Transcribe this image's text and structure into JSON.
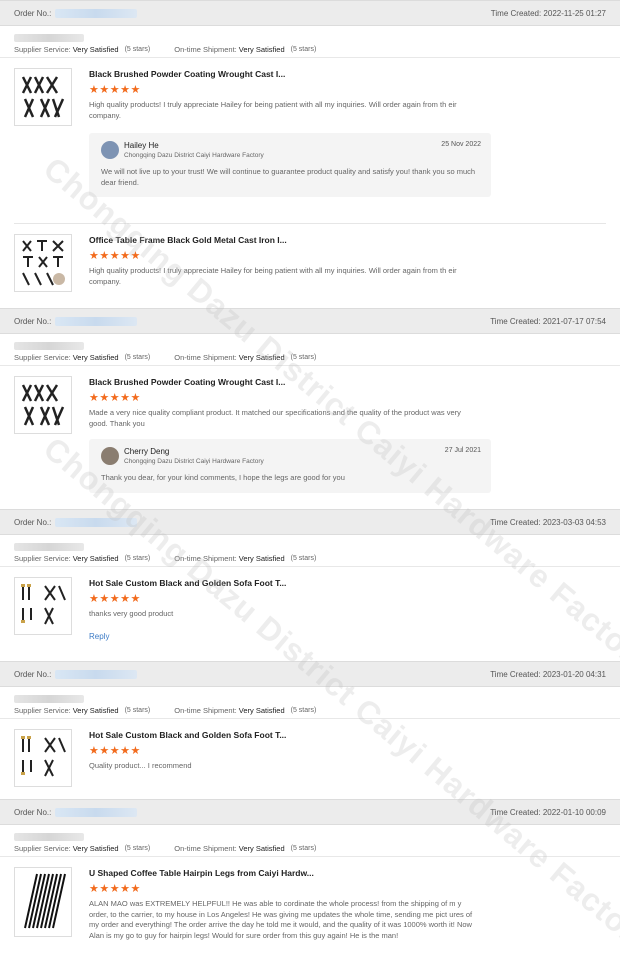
{
  "labels": {
    "order_no": "Order No.:",
    "time_created": "Time Created:",
    "supplier_service": "Supplier Service:",
    "ontime_shipment": "On-time Shipment:",
    "reply": "Reply"
  },
  "brand": {
    "star_color": "#f26b1d",
    "link_color": "#3c7bc6"
  },
  "watermark": "Chongqing Dazu District Caiyi Hardware Factory",
  "orders": [
    {
      "time_created": "2022-11-25 01:27",
      "supplier_service": "Very Satisfied",
      "supplier_stars": "(5 stars)",
      "shipment": "Very Satisfied",
      "shipment_stars": "(5 stars)",
      "reviews": [
        {
          "product": "Black Brushed Powder Coating Wrought Cast I...",
          "stars": "★★★★★",
          "comment": "High quality products! I truly appreciate Hailey for being patient with all my inquiries. Will order again from th eir company.",
          "reply": {
            "name": "Hailey He",
            "company": "Chongqing Dazu District Caiyi Hardware Factory",
            "date": "25 Nov 2022",
            "text": "We will not live up to your trust! We will continue to guarantee product quality and satisfy you! thank you so much dear friend."
          }
        },
        {
          "product": "Office Table Frame Black Gold Metal Cast Iron I...",
          "stars": "★★★★★",
          "comment": "High quality products! I truly appreciate Hailey for being patient with all my inquiries. Will order again from th eir company."
        }
      ]
    },
    {
      "time_created": "2021-07-17 07:54",
      "supplier_service": "Very Satisfied",
      "supplier_stars": "(5 stars)",
      "shipment": "Very Satisfied",
      "shipment_stars": "(5 stars)",
      "reviews": [
        {
          "product": "Black Brushed Powder Coating Wrought Cast I...",
          "stars": "★★★★★",
          "comment": "Made a very nice quality compliant product.  It matched our specifications and the quality of the product was very good.  Thank you",
          "reply": {
            "name": "Cherry Deng",
            "company": "Chongqing Dazu District Caiyi Hardware Factory",
            "date": "27 Jul 2021",
            "text": "Thank you dear, for your kind comments, I hope the legs are good for you"
          }
        }
      ]
    },
    {
      "time_created": "2023-03-03 04:53",
      "supplier_service": "Very Satisfied",
      "supplier_stars": "(5 stars)",
      "shipment": "Very Satisfied",
      "shipment_stars": "(5 stars)",
      "reviews": [
        {
          "product": "Hot Sale Custom Black and Golden Sofa Foot T...",
          "stars": "★★★★★",
          "comment": "thanks very good product"
        }
      ]
    },
    {
      "time_created": "2023-01-20 04:31",
      "supplier_service": "Very Satisfied",
      "supplier_stars": "(5 stars)",
      "shipment": "Very Satisfied",
      "shipment_stars": "(5 stars)",
      "reviews": [
        {
          "product": "Hot Sale Custom Black and Golden Sofa Foot T...",
          "stars": "★★★★★",
          "comment": "Quality product... I recommend"
        }
      ]
    },
    {
      "time_created": "2022-01-10 00:09",
      "supplier_service": "Very Satisfied",
      "supplier_stars": "(5 stars)",
      "shipment": "Very Satisfied",
      "shipment_stars": "(5 stars)",
      "reviews": [
        {
          "product": "U Shaped Coffee Table Hairpin Legs from Caiyi Hardw...",
          "stars": "★★★★★",
          "comment": "ALAN MAO was EXTREMELY HELPFUL!! He was able to cordinate the whole process! from the shipping of m y order, to the carrier, to my house in Los Angeles! He was giving me updates the whole time, sending me pict ures of my order and everything! The order arrive the day he told me it would, and the quality of it was 1000% worth it! Now Alan is my go to guy for hairpin legs! Would for sure order from this guy again! He is the man!"
        }
      ]
    }
  ]
}
